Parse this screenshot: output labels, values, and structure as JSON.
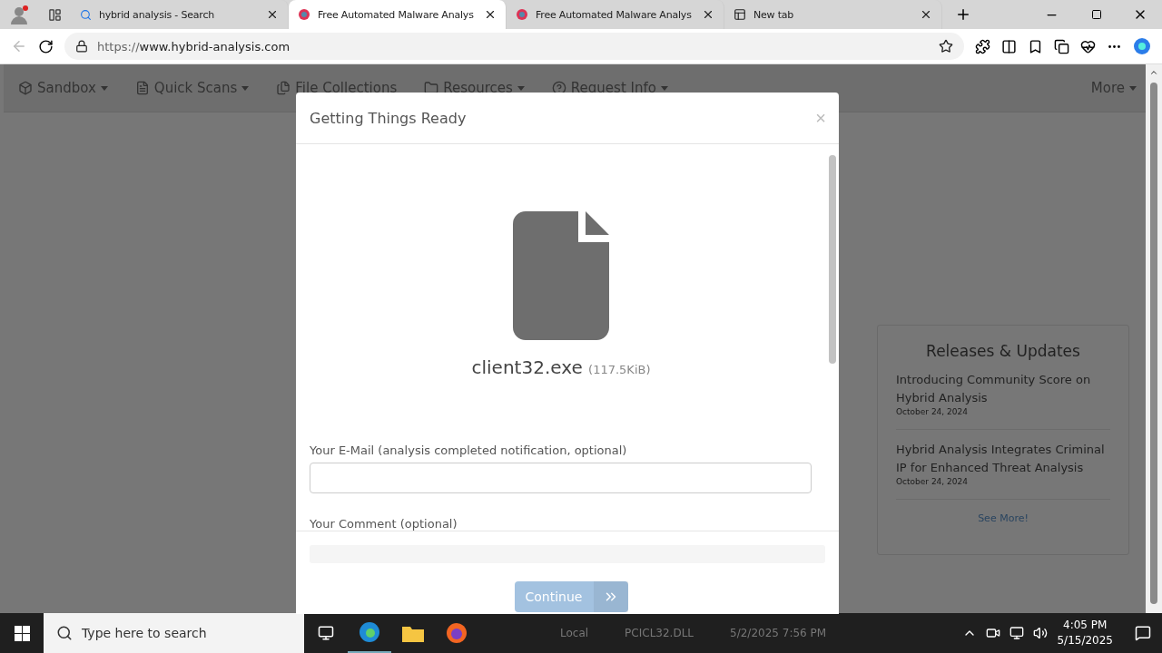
{
  "browser": {
    "tabs": [
      {
        "title": "hybrid analysis - Search",
        "kind": "search",
        "selected": false
      },
      {
        "title": "Free Automated Malware Analys",
        "kind": "site",
        "selected": true
      },
      {
        "title": "Free Automated Malware Analys",
        "kind": "site",
        "selected": false
      },
      {
        "title": "New tab",
        "kind": "newtab",
        "selected": false
      }
    ],
    "address": {
      "scheme": "https://",
      "host": "www.hybrid-analysis.com"
    }
  },
  "navbar": {
    "items": [
      {
        "label": "Sandbox",
        "kind": "cube",
        "dropdown": true
      },
      {
        "label": "Quick Scans",
        "kind": "file",
        "dropdown": true
      },
      {
        "label": "File Collections",
        "kind": "copy",
        "dropdown": false
      },
      {
        "label": "Resources",
        "kind": "folder",
        "dropdown": true
      },
      {
        "label": "Request Info",
        "kind": "question",
        "dropdown": true
      }
    ],
    "more": "More"
  },
  "releases": {
    "title": "Releases & Updates",
    "items": [
      {
        "title": "Introducing Community Score on Hybrid Analysis",
        "date": "October 24, 2024"
      },
      {
        "title": "Hybrid Analysis Integrates Criminal IP for Enhanced Threat Analysis",
        "date": "October 24, 2024"
      }
    ],
    "link": "See More!"
  },
  "modal": {
    "title": "Getting Things Ready",
    "close": "×",
    "file": {
      "name": "client32.exe",
      "size": "(117.5KiB)"
    },
    "email_label": "Your E-Mail (analysis completed notification, optional)",
    "comment_label": "Your Comment (optional)",
    "progress": {
      "level": 0
    },
    "continue": {
      "label": "Continue",
      "disabled": true
    }
  },
  "taskbar": {
    "search_placeholder": "Type here to search",
    "behind": [
      "Local",
      "PCICL32.DLL",
      "5/2/2025 7:56 PM"
    ],
    "time": "4:05 PM",
    "date": "5/15/2025"
  }
}
